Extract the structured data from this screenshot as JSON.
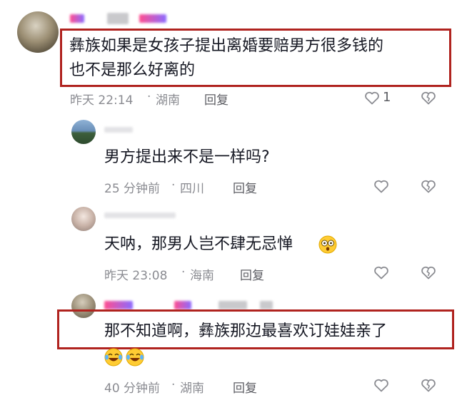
{
  "comments": [
    {
      "text_lines": [
        "彝族如果是女孩子提出离婚要赔男方很多钱的",
        "也不是那么好离的"
      ],
      "time": "昨天 22:14",
      "sep": "·",
      "location": "湖南",
      "reply_label": "回复",
      "like_count": "1",
      "like_icon": "heart-outline-icon",
      "dislike_icon": "broken-heart-icon"
    },
    {
      "text": "男方提出来不是一样吗?",
      "time": "25 分钟前",
      "sep": "·",
      "location": "四川",
      "reply_label": "回复"
    },
    {
      "text": "天呐，那男人岂不肆无忌惮",
      "emoji": "astonished-face-emoji",
      "time": "昨天 23:08",
      "sep": "·",
      "location": "海南",
      "reply_label": "回复"
    },
    {
      "text": "那不知道啊，彝族那边最喜欢订娃娃亲了",
      "emoji": "laughing-tears-emoji",
      "time": "40 分钟前",
      "sep": "·",
      "location": "湖南",
      "reply_label": "回复"
    }
  ],
  "colors": {
    "highlight_border": "#b0231f",
    "meta_text": "#8a8b91",
    "body_text": "#161823"
  }
}
